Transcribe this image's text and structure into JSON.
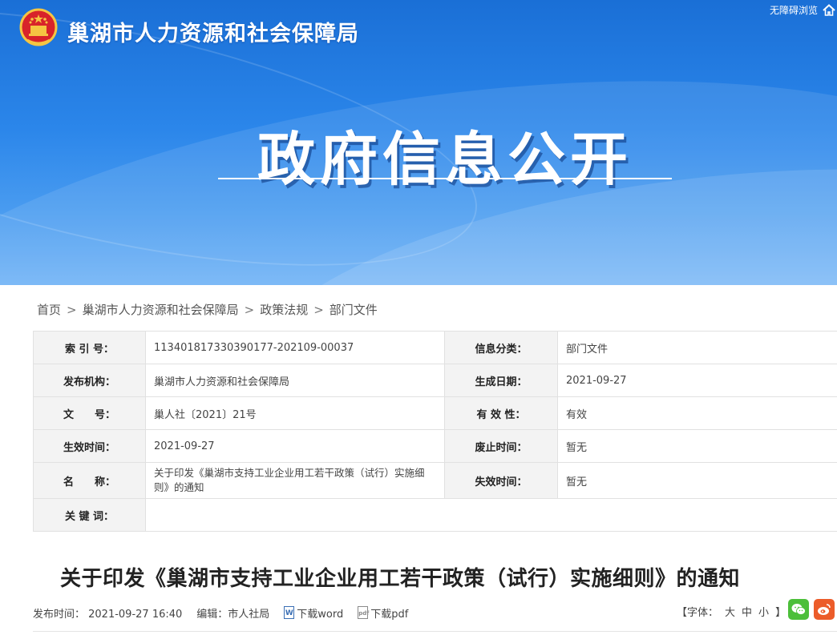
{
  "header": {
    "site_name": "巢湖市人力资源和社会保障局",
    "accessible_label": "无障碍浏览",
    "banner_title": "政府信息公开"
  },
  "breadcrumb": [
    "首页",
    "巢湖市人力资源和社会保障局",
    "政策法规",
    "部门文件"
  ],
  "breadcrumb_sep": ">",
  "meta": {
    "index_label": "索 引 号：",
    "index_value": "113401817330390177-202109-00037",
    "category_label": "信息分类：",
    "category_value": "部门文件",
    "publisher_label": "发布机构：",
    "publisher_value": "巢湖市人力资源和社会保障局",
    "created_label": "生成日期：",
    "created_value": "2021-09-27",
    "docno_label": "文　　号：",
    "docno_value": "巢人社〔2021〕21号",
    "validity_label": "有 效 性：",
    "validity_value": "有效",
    "effective_label": "生效时间：",
    "effective_value": "2021-09-27",
    "abolish_label": "废止时间：",
    "abolish_value": "暂无",
    "name_label": "名　　称：",
    "name_value": "关于印发《巢湖市支持工业企业用工若干政策（试行）实施细则》的通知",
    "expire_label": "失效时间：",
    "expire_value": "暂无",
    "keywords_label": "关 键 词：",
    "keywords_value": ""
  },
  "document": {
    "title": "关于印发《巢湖市支持工业企业用工若干政策（试行）实施细则》的通知",
    "publish_time": "发布时间： 2021-09-27 16:40",
    "editor": "编辑：市人社局",
    "download_word": "下载word",
    "download_pdf": "下载pdf",
    "font_label": "【字体：",
    "font_large": "大",
    "font_medium": "中",
    "font_small": "小",
    "font_close": "】"
  },
  "colors": {
    "banner_top": "#1a6fd6",
    "wechat": "#4cbf3a",
    "weibo": "#ec5c2a"
  }
}
